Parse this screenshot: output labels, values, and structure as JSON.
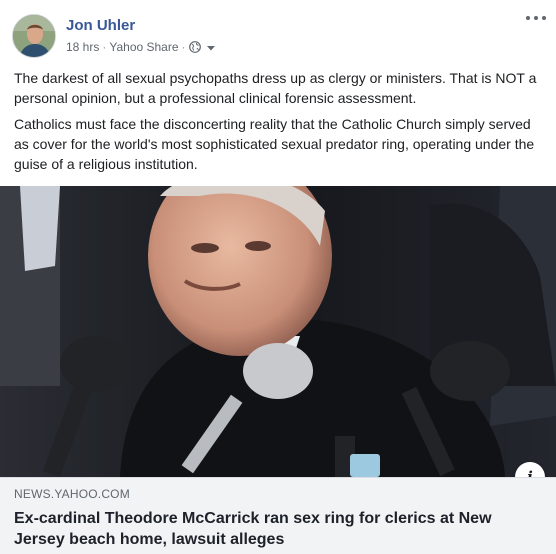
{
  "post": {
    "author": "Jon Uhler",
    "time": "18 hrs",
    "source": "Yahoo Share",
    "separator": "·",
    "privacy_icon": "globe-icon",
    "menu_icon": "more-options-icon",
    "paragraphs": [
      "The darkest of all sexual psychopaths dress up as clergy or ministers. That is NOT a personal opinion, but a professional clinical forensic assessment.",
      "Catholics must face the disconcerting reality that the Catholic Church simply served as cover for the world's most sophisticated sexual predator ring, operating under the guise of a religious institution."
    ]
  },
  "link": {
    "domain": "NEWS.YAHOO.COM",
    "title": "Ex-cardinal Theodore McCarrick ran sex ring for clerics at New Jersey beach home, lawsuit alleges",
    "info_icon": "info-icon",
    "info_glyph": "i"
  },
  "colors": {
    "author_link": "#385898",
    "meta_text": "#616770",
    "caption_bg": "#f2f3f5"
  }
}
